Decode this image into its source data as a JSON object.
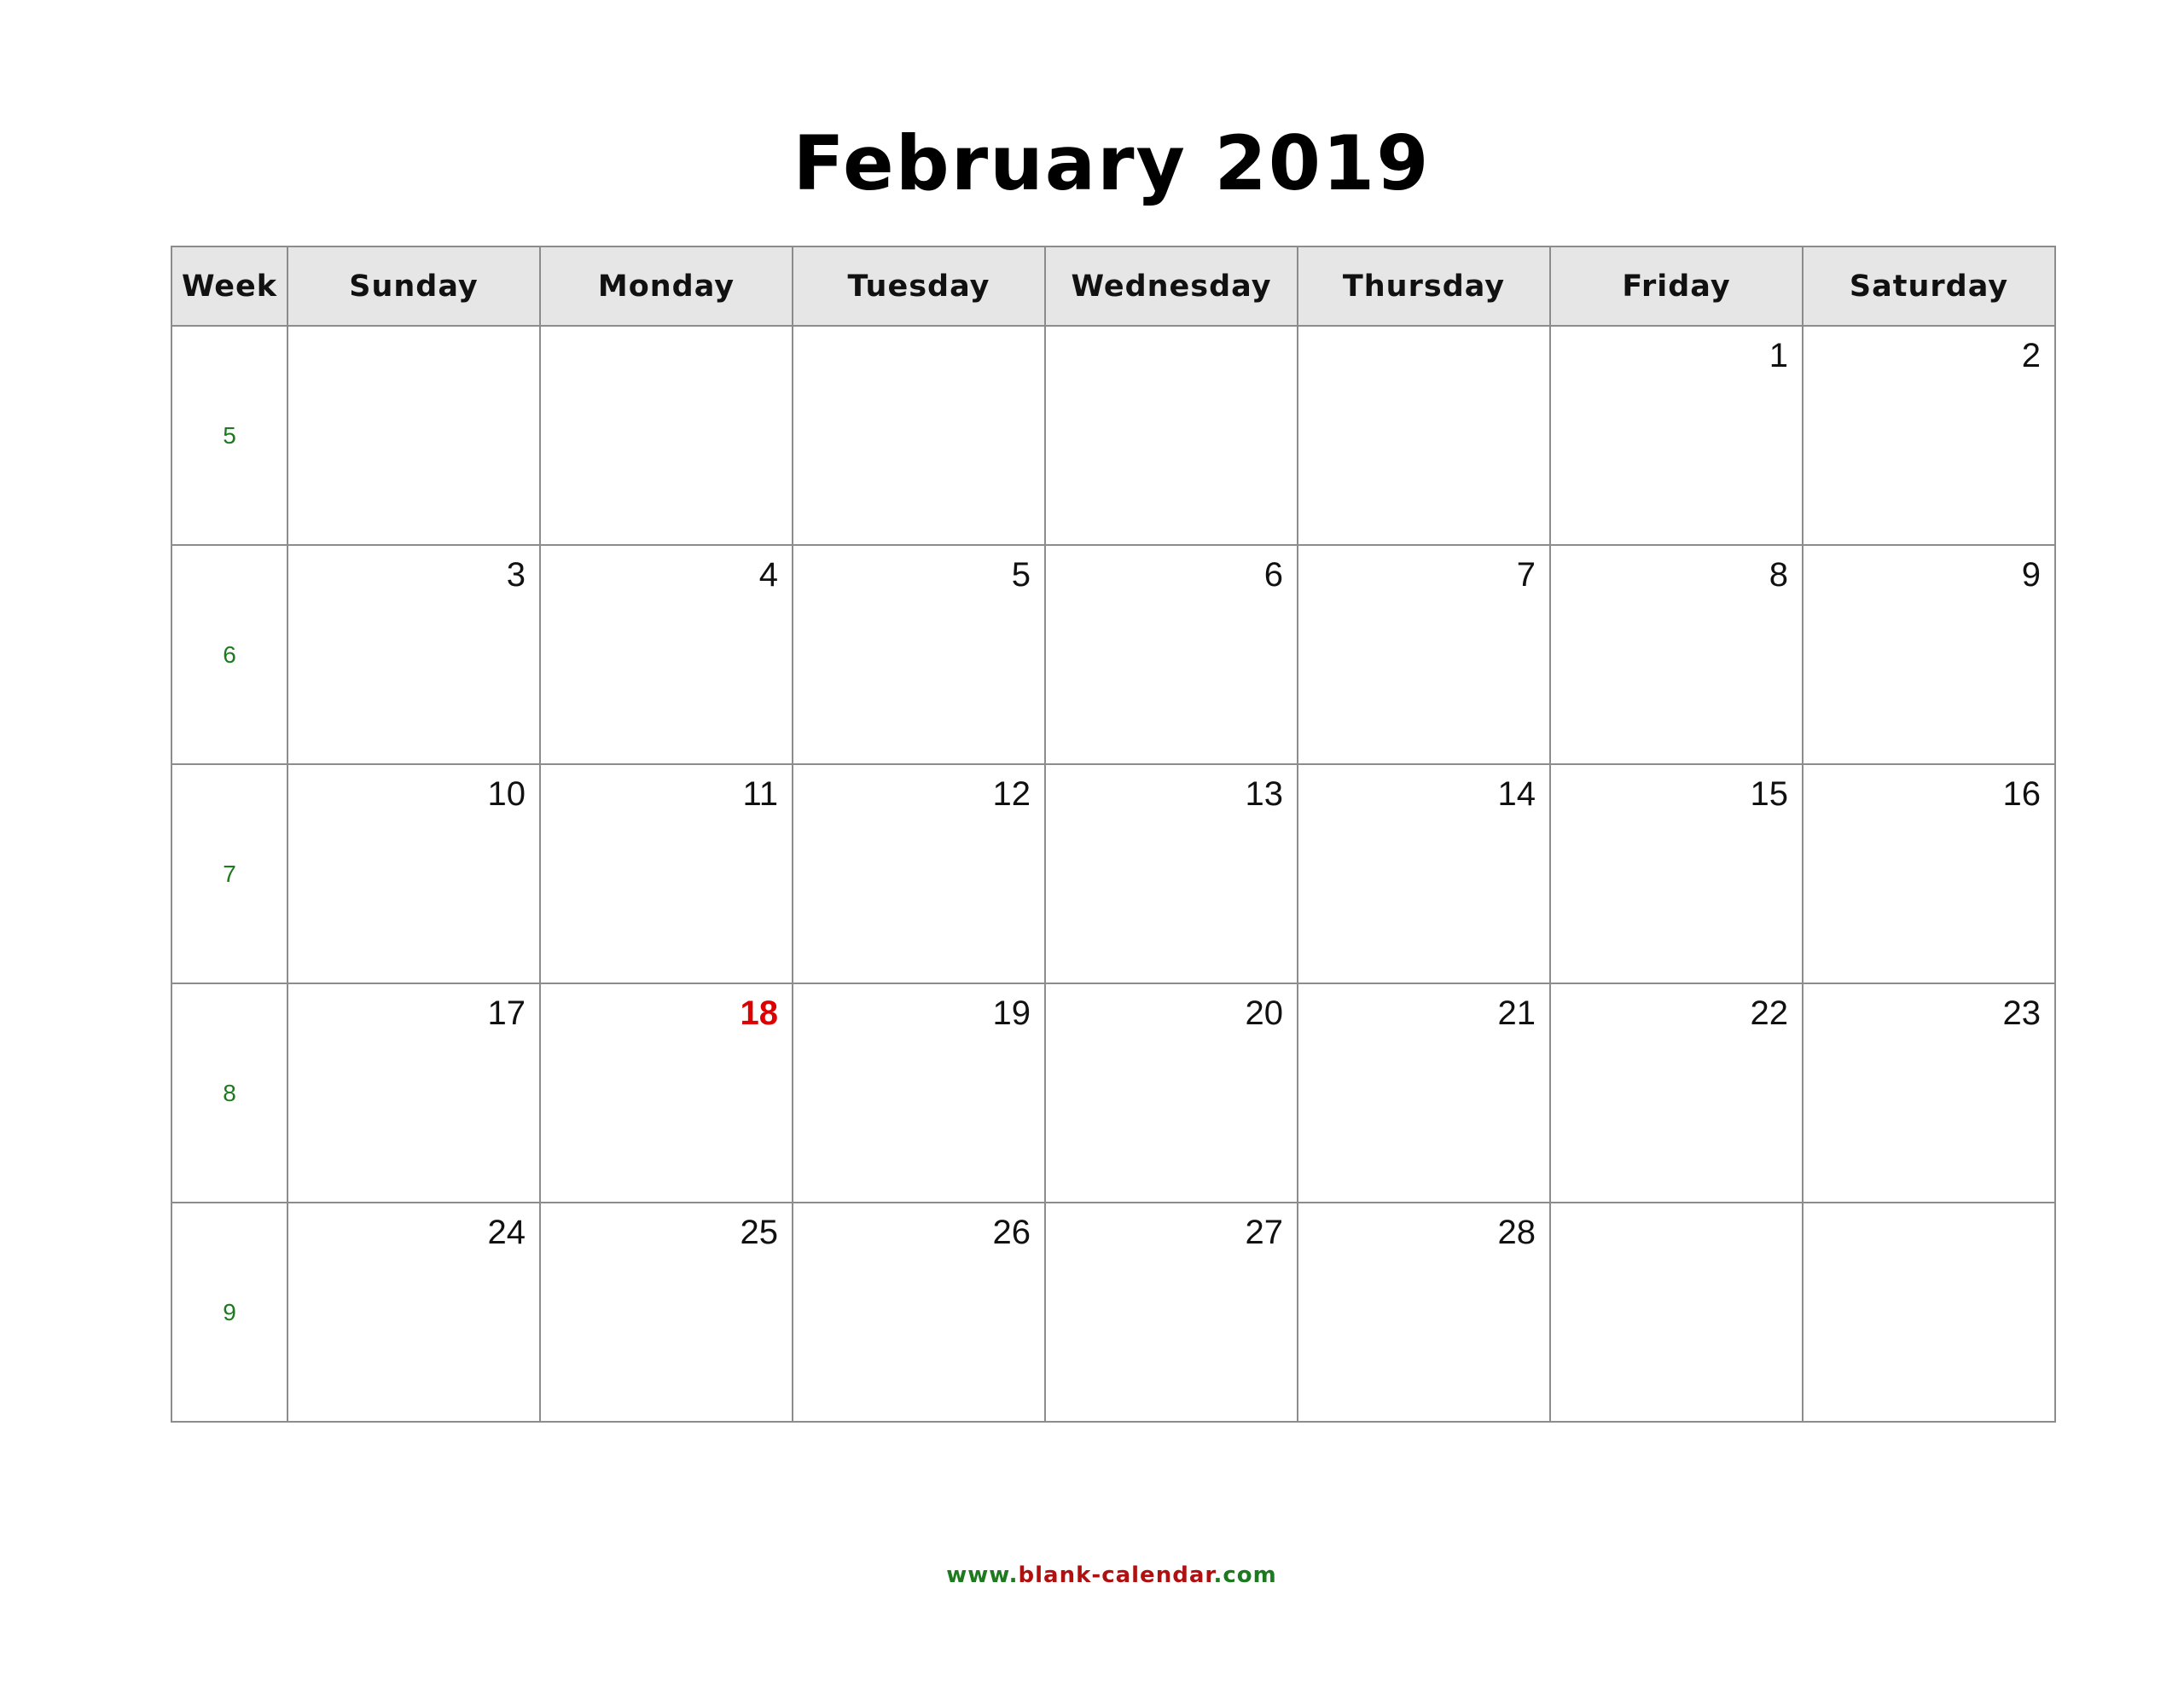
{
  "title": "February 2019",
  "header": {
    "week_label": "Week",
    "days": [
      "Sunday",
      "Monday",
      "Tuesday",
      "Wednesday",
      "Thursday",
      "Friday",
      "Saturday"
    ]
  },
  "colors": {
    "week_number": "#1e7a1e",
    "holiday": "#dd0000",
    "header_bg": "#e6e6e6",
    "grid": "#8c8c8c"
  },
  "weeks": [
    {
      "week": "5",
      "days": [
        "",
        "",
        "",
        "",
        "",
        "1",
        "2"
      ]
    },
    {
      "week": "6",
      "days": [
        "3",
        "4",
        "5",
        "6",
        "7",
        "8",
        "9"
      ]
    },
    {
      "week": "7",
      "days": [
        "10",
        "11",
        "12",
        "13",
        "14",
        "15",
        "16"
      ]
    },
    {
      "week": "8",
      "days": [
        "17",
        "18",
        "19",
        "20",
        "21",
        "22",
        "23"
      ]
    },
    {
      "week": "9",
      "days": [
        "24",
        "25",
        "26",
        "27",
        "28",
        "",
        ""
      ]
    }
  ],
  "holidays": [
    "18"
  ],
  "footer": {
    "prefix": "www.",
    "site": "blank-calendar",
    "suffix": ".com"
  }
}
